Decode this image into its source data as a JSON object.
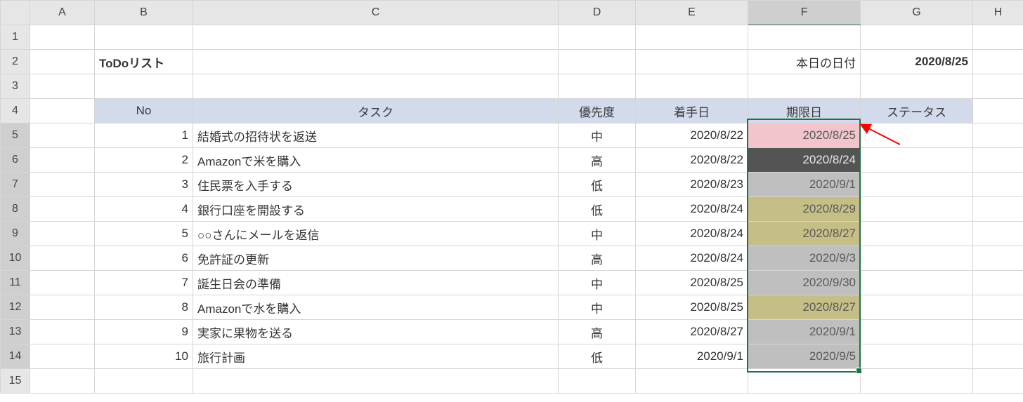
{
  "columns": [
    "A",
    "B",
    "C",
    "D",
    "E",
    "F",
    "G",
    "H"
  ],
  "col_widths": {
    "A": 92,
    "B": 140,
    "C": 520,
    "D": 110,
    "E": 160,
    "F": 160,
    "G": 160,
    "H": 72
  },
  "row_numbers": [
    1,
    2,
    3,
    4,
    5,
    6,
    7,
    8,
    9,
    10,
    11,
    12,
    13,
    14,
    15
  ],
  "row2": {
    "title": "ToDoリスト",
    "date_label": "本日の日付",
    "date_value": "2020/8/25"
  },
  "headers": {
    "no": "No",
    "task": "タスク",
    "priority": "優先度",
    "start": "着手日",
    "deadline": "期限日",
    "status": "ステータス"
  },
  "rows": [
    {
      "no": 1,
      "task": "結婚式の招待状を返送",
      "prio": "中",
      "start": "2020/8/22",
      "deadline": "2020/8/25",
      "hl": "pink"
    },
    {
      "no": 2,
      "task": "Amazonで米を購入",
      "prio": "高",
      "start": "2020/8/22",
      "deadline": "2020/8/24",
      "hl": "dark"
    },
    {
      "no": 3,
      "task": "住民票を入手する",
      "prio": "低",
      "start": "2020/8/23",
      "deadline": "2020/9/1",
      "hl": "gray"
    },
    {
      "no": 4,
      "task": "銀行口座を開設する",
      "prio": "低",
      "start": "2020/8/24",
      "deadline": "2020/8/29",
      "hl": "olive"
    },
    {
      "no": 5,
      "task": "○○さんにメールを返信",
      "prio": "中",
      "start": "2020/8/24",
      "deadline": "2020/8/27",
      "hl": "olive"
    },
    {
      "no": 6,
      "task": "免許証の更新",
      "prio": "高",
      "start": "2020/8/24",
      "deadline": "2020/9/3",
      "hl": "gray"
    },
    {
      "no": 7,
      "task": "誕生日会の準備",
      "prio": "中",
      "start": "2020/8/25",
      "deadline": "2020/9/30",
      "hl": "gray"
    },
    {
      "no": 8,
      "task": "Amazonで水を購入",
      "prio": "中",
      "start": "2020/8/25",
      "deadline": "2020/8/27",
      "hl": "olive"
    },
    {
      "no": 9,
      "task": "実家に果物を送る",
      "prio": "高",
      "start": "2020/8/27",
      "deadline": "2020/9/1",
      "hl": "gray"
    },
    {
      "no": 10,
      "task": "旅行計画",
      "prio": "低",
      "start": "2020/9/1",
      "deadline": "2020/9/5",
      "hl": "gray"
    }
  ]
}
